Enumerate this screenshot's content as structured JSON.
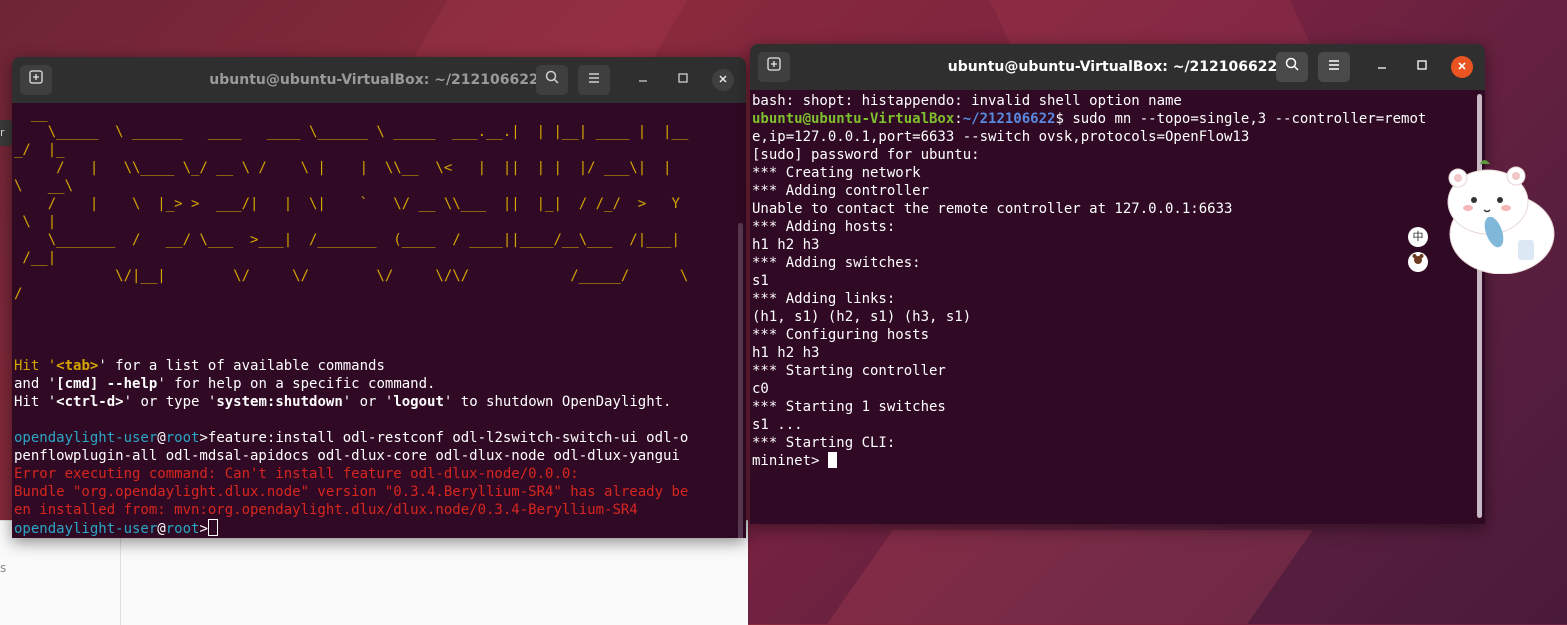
{
  "colors": {
    "terminal_bg": "#300a24",
    "titlebar_bg": "#2f2f2f",
    "close_red": "#e95420",
    "prompt_cyan": "#2aa6c7",
    "error_red": "#d7261f",
    "banner_yellow": "#d4a500",
    "user_green": "#7fbf2e",
    "path_blue": "#5a8ae0"
  },
  "left_terminal": {
    "title": "ubuntu@ubuntu-VirtualBox: ~/212106622",
    "icons": {
      "new_tab": "new-tab-icon",
      "search": "search-icon",
      "menu": "hamburger-menu-icon",
      "minimize": "minimize-icon",
      "maximize": "maximize-icon",
      "close": "close-icon"
    },
    "banner": [
      "  __",
      "    \\_____  \\ ______   ____   ____ \\______ \\ _____  ___.__.|  | |__| ____ |  |__",
      "_/  |_",
      "     /   |   \\\\____ \\_/ __ \\ /    \\ |    |  \\\\__  \\<   |  ||  | |  |/ ___\\|  |",
      "\\   __\\",
      "    /    |    \\  |_> >  ___/|   |  \\|    `   \\/ __ \\\\___  ||  |_|  / /_/  >   Y",
      " \\  |",
      "    \\_______  /   __/ \\___  >___|  /_______  (____  / ____||____/__\\___  /|___|",
      " /__|",
      "            \\/|__|        \\/     \\/        \\/     \\/\\/            /_____/      \\",
      "/"
    ],
    "help": {
      "l1_pre": "Hit '",
      "l1_key": "<tab>",
      "l1_post": "' for a list of available commands",
      "l2_pre": "and '",
      "l2_key": "[cmd] --help",
      "l2_post": "' for help on a specific command.",
      "l3_pre": "Hit '",
      "l3_key": "<ctrl-d>",
      "l3_mid1": "' or type '",
      "l3_key2": "system:shutdown",
      "l3_mid2": "' or '",
      "l3_key3": "logout",
      "l3_post": "' to shutdown OpenDaylight."
    },
    "prompt_user": "opendaylight-user",
    "prompt_at": "@",
    "prompt_host": "root",
    "prompt_gt": ">",
    "command_l1": "feature:install odl-restconf odl-l2switch-switch-ui odl-o",
    "command_l2": "penflowplugin-all odl-mdsal-apidocs odl-dlux-core odl-dlux-node odl-dlux-yangui",
    "error_l1": "Error executing command: Can't install feature odl-dlux-node/0.0.0:",
    "error_l2": "Bundle \"org.opendaylight.dlux.node\" version \"0.3.4.Beryllium-SR4\" has already be",
    "error_l3": "en installed from: mvn:org.opendaylight.dlux/dlux.node/0.3.4-Beryllium-SR4"
  },
  "right_terminal": {
    "title": "ubuntu@ubuntu-VirtualBox: ~/212106622",
    "icons": {
      "new_tab": "new-tab-icon",
      "search": "search-icon",
      "menu": "hamburger-menu-icon",
      "minimize": "minimize-icon",
      "maximize": "maximize-icon",
      "close": "close-icon"
    },
    "line0": "bash: shopt: histappendo: invalid shell option name",
    "prompt_user": "ubuntu@ubuntu-VirtualBox",
    "prompt_colon": ":",
    "prompt_path": "~/212106622",
    "prompt_dollar": "$ ",
    "cmd_l1": "sudo mn --topo=single,3 --controller=remot",
    "cmd_l2": "e,ip=127.0.0.1,port=6633 --switch ovsk,protocols=OpenFlow13",
    "output": [
      "[sudo] password for ubuntu:",
      "*** Creating network",
      "*** Adding controller",
      "Unable to contact the remote controller at 127.0.0.1:6633",
      "*** Adding hosts:",
      "h1 h2 h3",
      "*** Adding switches:",
      "s1",
      "*** Adding links:",
      "(h1, s1) (h2, s1) (h3, s1)",
      "*** Configuring hosts",
      "h1 h2 h3",
      "*** Starting controller",
      "c0",
      "*** Starting 1 switches",
      "s1 ...",
      "*** Starting CLI:"
    ],
    "final_prompt": "mininet> "
  },
  "ime": {
    "lang": "中",
    "skin": "skin-icon"
  },
  "bg_file_window": {
    "side_text": "s"
  },
  "bg_tab_text": "r"
}
